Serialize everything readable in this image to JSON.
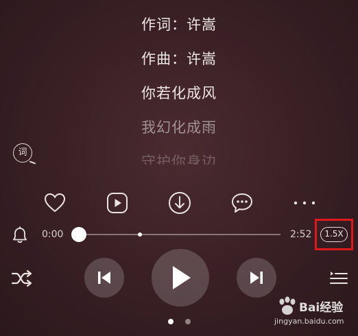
{
  "lyrics": {
    "lines": [
      "作词：许嵩",
      "作曲：许嵩",
      "你若化成风",
      "我幻化成雨",
      "守护你身边"
    ],
    "toggle_label": "词"
  },
  "actions": {
    "icons": [
      "heart-icon",
      "video-play-icon",
      "download-icon",
      "comment-icon",
      "more-icon"
    ]
  },
  "progress": {
    "current_time": "0:00",
    "total_time": "2:52",
    "position_fraction": 0.0,
    "speed_label": "1.5X"
  },
  "controls": {
    "icons": [
      "shuffle-icon",
      "previous-icon",
      "play-icon",
      "next-icon",
      "playlist-icon"
    ]
  },
  "pager": {
    "count": 2,
    "active": 0
  },
  "watermark": {
    "brand": "Bai经验",
    "url": "jingyan.baidu.com"
  },
  "colors": {
    "highlight": "#e01a1a",
    "background": "#3b2126"
  }
}
